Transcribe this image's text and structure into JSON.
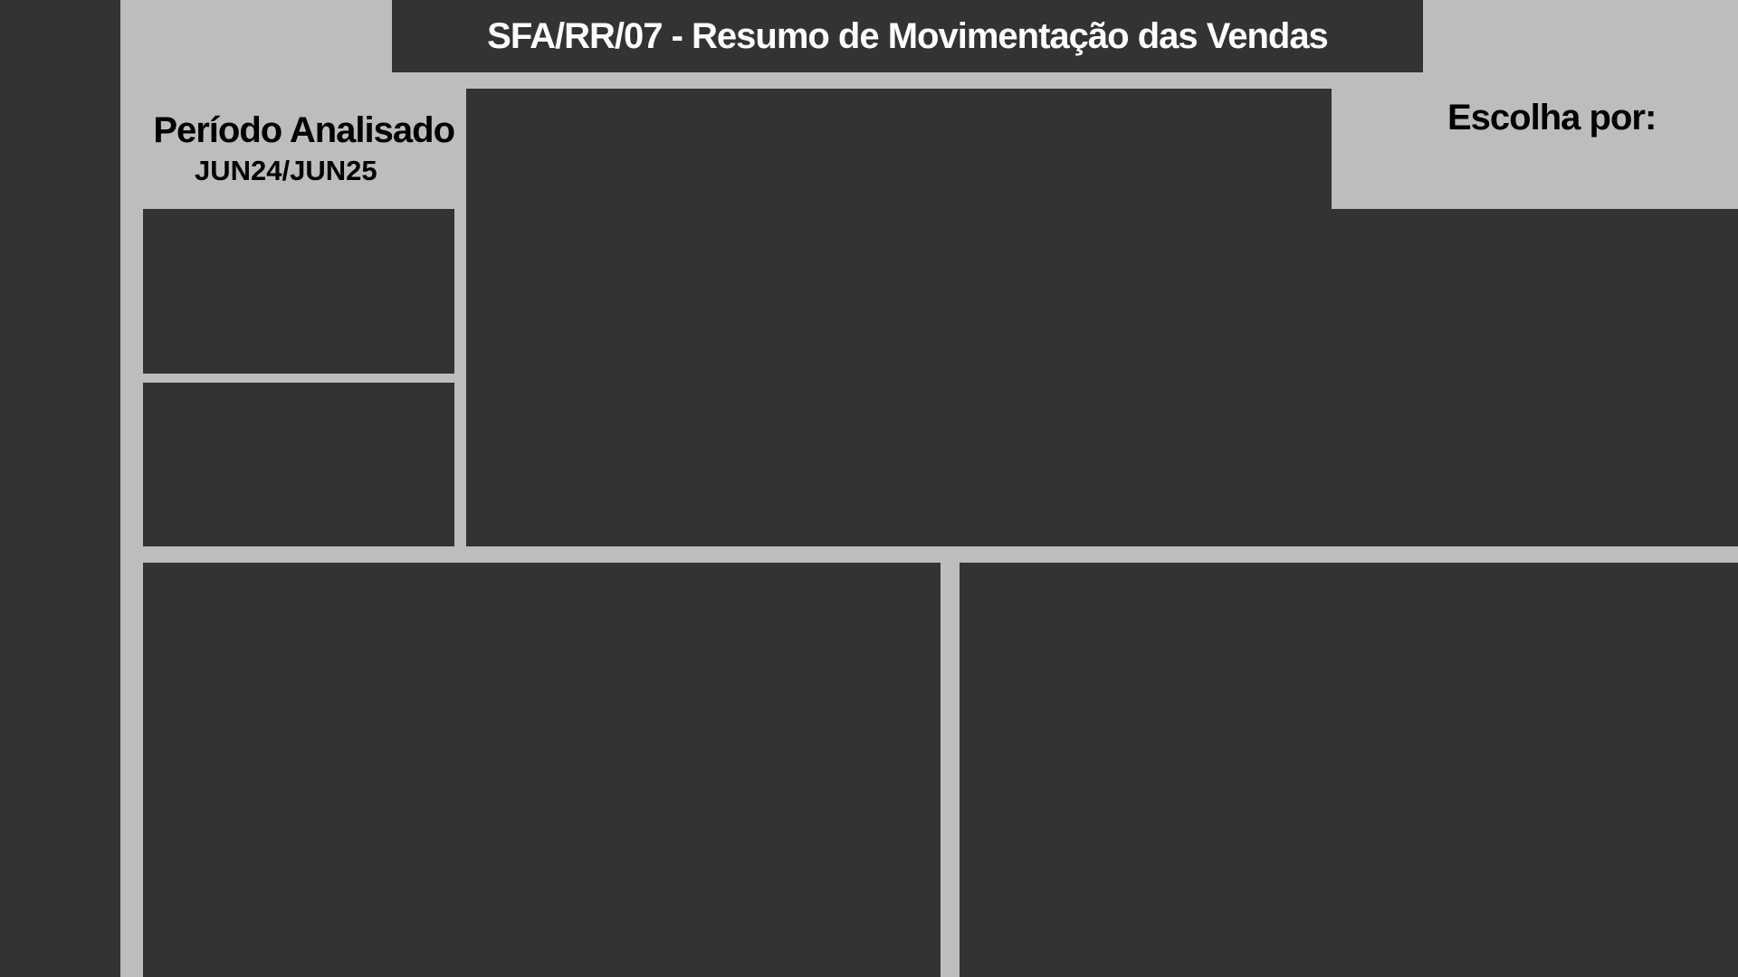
{
  "header": {
    "title": "SFA/RR/07 - Resumo de Movimentação das Vendas"
  },
  "period": {
    "label": "Período Analisado",
    "value": "JUN24/JUN25"
  },
  "filter": {
    "label": "Escolha por:"
  },
  "colors": {
    "background": "#bdbdbd",
    "panel": "#333333",
    "title_text": "#ffffff",
    "label_text": "#000000"
  }
}
